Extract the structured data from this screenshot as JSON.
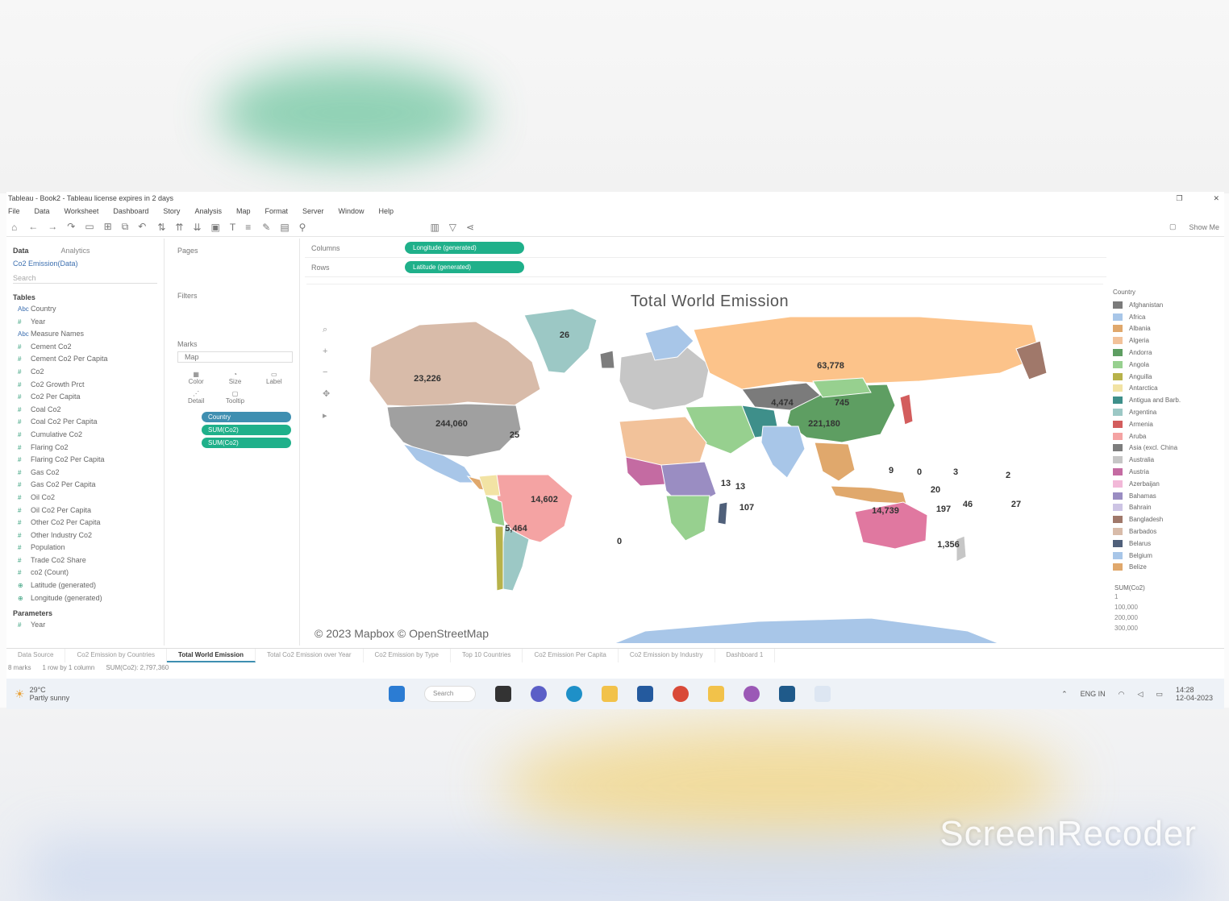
{
  "window": {
    "title": "Tableau - Book2 - Tableau license expires in 2 days",
    "restore_glyph": "❐",
    "close_glyph": "✕"
  },
  "menu": [
    "File",
    "Data",
    "Worksheet",
    "Dashboard",
    "Story",
    "Analysis",
    "Map",
    "Format",
    "Server",
    "Window",
    "Help"
  ],
  "toolbar": {
    "show_me": "Show Me"
  },
  "data_pane": {
    "tab_data": "Data",
    "tab_analytics": "Analytics",
    "source": "Co2 Emission(Data)",
    "search_placeholder": "Search",
    "tables_header": "Tables",
    "fields": [
      {
        "type": "Abc",
        "name": "Country"
      },
      {
        "type": "#",
        "name": "Year"
      },
      {
        "type": "Abc",
        "name": "Measure Names"
      },
      {
        "type": "#",
        "name": "Cement Co2"
      },
      {
        "type": "#",
        "name": "Cement Co2 Per Capita"
      },
      {
        "type": "#",
        "name": "Co2"
      },
      {
        "type": "#",
        "name": "Co2 Growth Prct"
      },
      {
        "type": "#",
        "name": "Co2 Per Capita"
      },
      {
        "type": "#",
        "name": "Coal Co2"
      },
      {
        "type": "#",
        "name": "Coal Co2 Per Capita"
      },
      {
        "type": "#",
        "name": "Cumulative Co2"
      },
      {
        "type": "#",
        "name": "Flaring Co2"
      },
      {
        "type": "#",
        "name": "Flaring Co2 Per Capita"
      },
      {
        "type": "#",
        "name": "Gas Co2"
      },
      {
        "type": "#",
        "name": "Gas Co2 Per Capita"
      },
      {
        "type": "#",
        "name": "Oil Co2"
      },
      {
        "type": "#",
        "name": "Oil Co2 Per Capita"
      },
      {
        "type": "#",
        "name": "Other Co2 Per Capita"
      },
      {
        "type": "#",
        "name": "Other Industry Co2"
      },
      {
        "type": "#",
        "name": "Population"
      },
      {
        "type": "#",
        "name": "Trade Co2 Share"
      },
      {
        "type": "#",
        "name": "co2 (Count)"
      },
      {
        "type": "⊕",
        "name": "Latitude (generated)"
      },
      {
        "type": "⊕",
        "name": "Longitude (generated)"
      }
    ],
    "parameters_header": "Parameters",
    "parameters": [
      {
        "type": "#",
        "name": "Year"
      }
    ]
  },
  "cards": {
    "pages": "Pages",
    "filters": "Filters",
    "marks": "Marks",
    "mark_type": "Map",
    "mark_buttons": [
      "Color",
      "Size",
      "Label",
      "Detail",
      "Tooltip"
    ],
    "mark_pills": [
      "Country",
      "SUM(Co2)",
      "SUM(Co2)"
    ]
  },
  "shelves": {
    "columns_label": "Columns",
    "columns_pill": "Longitude (generated)",
    "rows_label": "Rows",
    "rows_pill": "Latitude (generated)"
  },
  "viz": {
    "title": "Total  World Emission",
    "credit": "© 2023 Mapbox © OpenStreetMap",
    "map_labels": [
      "26",
      "23,226",
      "244,060",
      "25",
      "63,778",
      "745",
      "221,180",
      "14,602",
      "14,739",
      "1,356",
      "107",
      "13",
      "0",
      "3",
      "2",
      "27",
      "5,464",
      "9",
      "20",
      "197",
      "46",
      "4,474",
      "13",
      "0"
    ]
  },
  "legend": {
    "title": "Country",
    "items": [
      {
        "name": "Afghanistan",
        "color": "#7b7b7b"
      },
      {
        "name": "Africa",
        "color": "#a8c6e8"
      },
      {
        "name": "Albania",
        "color": "#e0a86c"
      },
      {
        "name": "Algeria",
        "color": "#f2c29a"
      },
      {
        "name": "Andorra",
        "color": "#5e9e62"
      },
      {
        "name": "Angola",
        "color": "#97d08f"
      },
      {
        "name": "Anguilla",
        "color": "#b7b24a"
      },
      {
        "name": "Antarctica",
        "color": "#f2e3a4"
      },
      {
        "name": "Antigua and Barb.",
        "color": "#3e8f8a"
      },
      {
        "name": "Argentina",
        "color": "#9cc8c5"
      },
      {
        "name": "Armenia",
        "color": "#d35d5d"
      },
      {
        "name": "Aruba",
        "color": "#f4a3a3"
      },
      {
        "name": "Asia (excl. China",
        "color": "#7d7d7d"
      },
      {
        "name": "Australia",
        "color": "#c6c6c6"
      },
      {
        "name": "Austria",
        "color": "#c46ba2"
      },
      {
        "name": "Azerbaijan",
        "color": "#f2b8d8"
      },
      {
        "name": "Bahamas",
        "color": "#9a8dc2"
      },
      {
        "name": "Bahrain",
        "color": "#cdc4e4"
      },
      {
        "name": "Bangladesh",
        "color": "#a0786a"
      },
      {
        "name": "Barbados",
        "color": "#d8bba9"
      },
      {
        "name": "Belarus",
        "color": "#50607a"
      },
      {
        "name": "Belgium",
        "color": "#a8c6e8"
      },
      {
        "name": "Belize",
        "color": "#e0a86c"
      }
    ],
    "sub_title": "SUM(Co2)",
    "sub_rows": [
      "1",
      "100,000",
      "200,000",
      "300,000"
    ]
  },
  "sheets": [
    "Data Source",
    "Co2 Emission by Countries",
    "Total World Emission",
    "Total Co2 Emission over Year",
    "Co2 Emission by Type",
    "Top 10 Countries",
    "Co2 Emission Per Capita",
    "Co2 Emission by Industry",
    "Dashboard 1"
  ],
  "active_sheet": "Total World Emission",
  "status": {
    "marks": "8 marks",
    "rows": "1 row by 1 column",
    "sum": "SUM(Co2): 2,797,360"
  },
  "taskbar": {
    "weather_temp": "29°C",
    "weather_desc": "Partly sunny",
    "search": "Search",
    "lang": "ENG IN",
    "time": "14:28",
    "date": "12-04-2023"
  },
  "watermark": "ScreenRecoder",
  "colors": {
    "accent_pill": "#1fb08a",
    "accent_blue": "#3f8fb1",
    "ocean": "#ffffff"
  }
}
